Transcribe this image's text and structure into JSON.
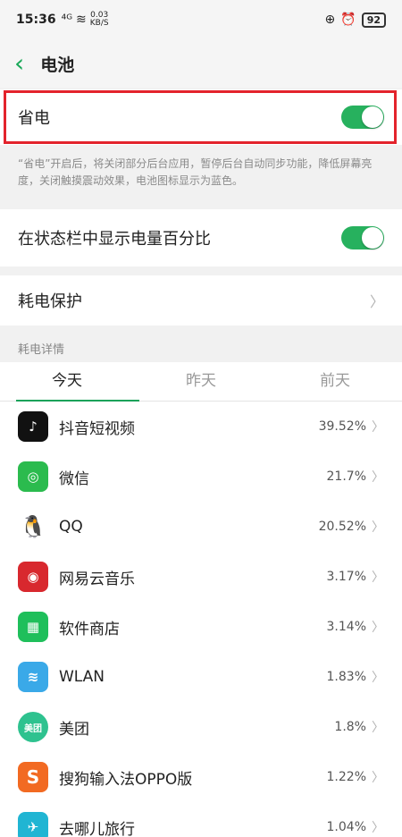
{
  "status": {
    "time": "15:36",
    "signal": "⁴ᴳ",
    "net_speed_top": "0.03",
    "net_speed_bottom": "KB/S",
    "battery": "92"
  },
  "header": {
    "back": "‹",
    "title": "电池"
  },
  "power_saving": {
    "label": "省电",
    "enabled": true
  },
  "power_desc": "“省电”开启后，将关闭部分后台应用，暂停后台自动同步功能，降低屏幕亮度，关闭触摸震动效果，电池图标显示为蓝色。",
  "show_percent": {
    "label": "在状态栏中显示电量百分比",
    "enabled": true
  },
  "protection": {
    "label": "耗电保护"
  },
  "details_label": "耗电详情",
  "tabs": [
    {
      "label": "今天"
    },
    {
      "label": "昨天"
    },
    {
      "label": "前天"
    }
  ],
  "apps": [
    {
      "name": "抖音短视频",
      "percent": "39.52%",
      "icon": "douyin-icon",
      "color": "#111111",
      "glyph": "♪"
    },
    {
      "name": "微信",
      "percent": "21.7%",
      "icon": "wechat-icon",
      "color": "#2bbb4e",
      "glyph": "◎"
    },
    {
      "name": "QQ",
      "percent": "20.52%",
      "icon": "qq-icon",
      "color": "#ffffff",
      "glyph": "🐧"
    },
    {
      "name": "网易云音乐",
      "percent": "3.17%",
      "icon": "netease-music-icon",
      "color": "#d8282e",
      "glyph": "◉"
    },
    {
      "name": "软件商店",
      "percent": "3.14%",
      "icon": "app-store-icon",
      "color": "#1fbf5b",
      "glyph": "▦"
    },
    {
      "name": "WLAN",
      "percent": "1.83%",
      "icon": "wifi-icon",
      "color": "#3aa9e8",
      "glyph": "≋"
    },
    {
      "name": "美团",
      "percent": "1.8%",
      "icon": "meituan-icon",
      "color": "#2ec28f",
      "glyph": "美团"
    },
    {
      "name": "搜狗输入法OPPO版",
      "percent": "1.22%",
      "icon": "sogou-icon",
      "color": "#f26a22",
      "glyph": "S"
    },
    {
      "name": "去哪儿旅行",
      "percent": "1.04%",
      "icon": "qunar-icon",
      "color": "#20b5d3",
      "glyph": "✈"
    }
  ],
  "chevron": "〉",
  "accent": "#27b15e"
}
